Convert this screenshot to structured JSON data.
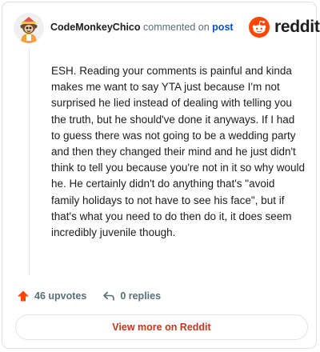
{
  "header": {
    "username": "CodeMonkeyChico",
    "action_text": "commented on",
    "post_link": "post"
  },
  "brand": {
    "name": "reddit",
    "icon": "reddit-logo-icon",
    "color": "#ff4500"
  },
  "comment": {
    "text": "ESH. Reading your comments is painful and kinda makes me want to say YTA just because I'm not surprised he lied instead of dealing with telling you the truth, but he should've done it anyways. If I had to guess there was not going to be a wedding party and then they changed their mind and he just didn't think to tell you because you're not in it so why would he. He certainly didn't do anything that's \"avoid family holidays to not have to see his face\", but if that's what you need to do then do it, it does seem incredibly juvenile though."
  },
  "actions": {
    "upvotes": "46 upvotes",
    "upvote_icon": "upvote-arrow-icon",
    "replies": "0 replies",
    "reply_icon": "reply-arrow-icon"
  },
  "footer": {
    "view_more_label": "View more on Reddit"
  }
}
